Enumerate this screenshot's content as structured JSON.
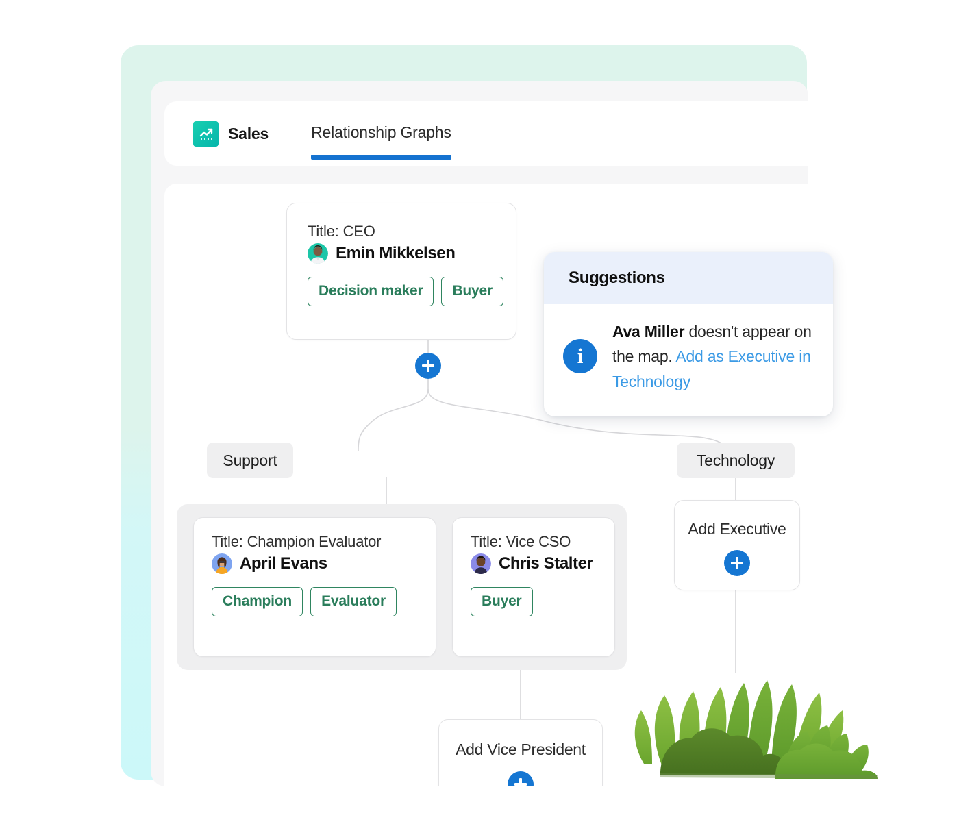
{
  "app": {
    "name": "Sales",
    "icon": "trending-chart-icon",
    "accent_blue": "#1576d2",
    "accent_teal": "#0ec2ae",
    "tag_green": "#2a7d5b",
    "backdrop_mint": "#ddf4ec",
    "backdrop_cyan": "#ccf8f9"
  },
  "tabs": [
    {
      "label": "Relationship Graphs",
      "active": true
    }
  ],
  "graph": {
    "root": {
      "title": "Title: CEO",
      "name": "Emin Mikkelsen",
      "avatar": "avatar-emin-mikkelsen",
      "tags": [
        "Decision maker",
        "Buyer"
      ]
    },
    "root_add_button": "add-node-button",
    "branches": [
      {
        "label": "Support",
        "members": [
          {
            "title": "Title: Champion Evaluator",
            "name": "April Evans",
            "avatar": "avatar-april-evans",
            "tags": [
              "Champion",
              "Evaluator"
            ]
          },
          {
            "title": "Title: Vice CSO",
            "name": "Chris Stalter",
            "avatar": "avatar-chris-stalter",
            "tags": [
              "Buyer"
            ]
          }
        ],
        "add_card": {
          "label": "Add Vice President"
        }
      },
      {
        "label": "Technology",
        "members": [],
        "add_card": {
          "label": "Add Executive"
        }
      }
    ]
  },
  "suggestions": {
    "title": "Suggestions",
    "icon": "info-icon",
    "items": [
      {
        "subject": "Ava Miller",
        "body": " doesn't appear on the map. ",
        "link": "Add as Executive in Technology"
      }
    ]
  },
  "decoration": {
    "plants": "bush-illustration"
  }
}
